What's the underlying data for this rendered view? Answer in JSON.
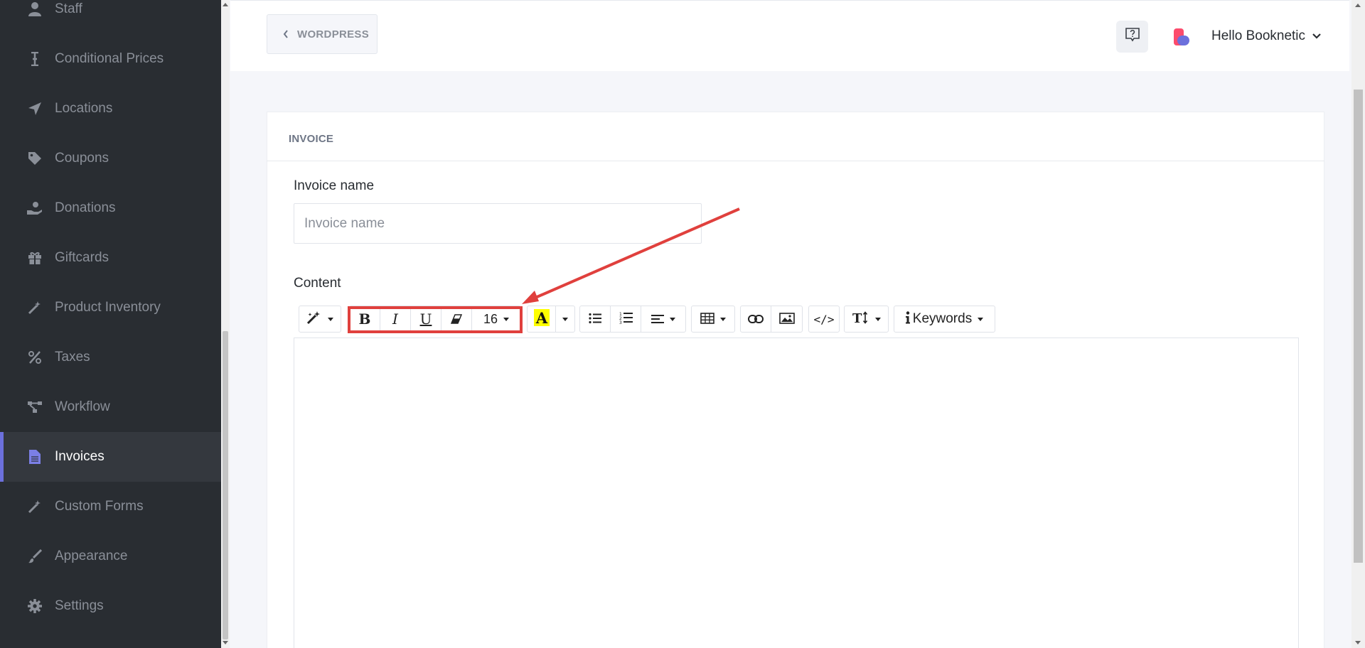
{
  "sidebar": {
    "items": [
      {
        "label": "Staff",
        "icon": "user-icon"
      },
      {
        "label": "Conditional Prices",
        "icon": "i-cursor-icon"
      },
      {
        "label": "Locations",
        "icon": "location-arrow-icon"
      },
      {
        "label": "Coupons",
        "icon": "tag-icon"
      },
      {
        "label": "Donations",
        "icon": "hand-holding-icon"
      },
      {
        "label": "Giftcards",
        "icon": "gift-icon"
      },
      {
        "label": "Product Inventory",
        "icon": "magic-wand-icon"
      },
      {
        "label": "Taxes",
        "icon": "percent-icon"
      },
      {
        "label": "Workflow",
        "icon": "workflow-icon"
      },
      {
        "label": "Invoices",
        "icon": "file-icon",
        "active": true
      },
      {
        "label": "Custom Forms",
        "icon": "magic-wand-icon"
      },
      {
        "label": "Appearance",
        "icon": "brush-icon"
      },
      {
        "label": "Settings",
        "icon": "gear-icon"
      }
    ]
  },
  "header": {
    "back_label": "WORDPRESS",
    "user_greeting": "Hello Booknetic"
  },
  "card": {
    "title": "INVOICE",
    "invoice_name_label": "Invoice name",
    "invoice_name_placeholder": "Invoice name",
    "invoice_name_value": "",
    "content_label": "Content"
  },
  "toolbar": {
    "font_size": "16",
    "keywords_label": "Keywords",
    "code_label": "</>"
  },
  "colors": {
    "sidebar_bg": "#292d32",
    "accent": "#6c70dc",
    "highlight_red": "#e0403d",
    "text_highlight_yellow": "#ffff00"
  }
}
